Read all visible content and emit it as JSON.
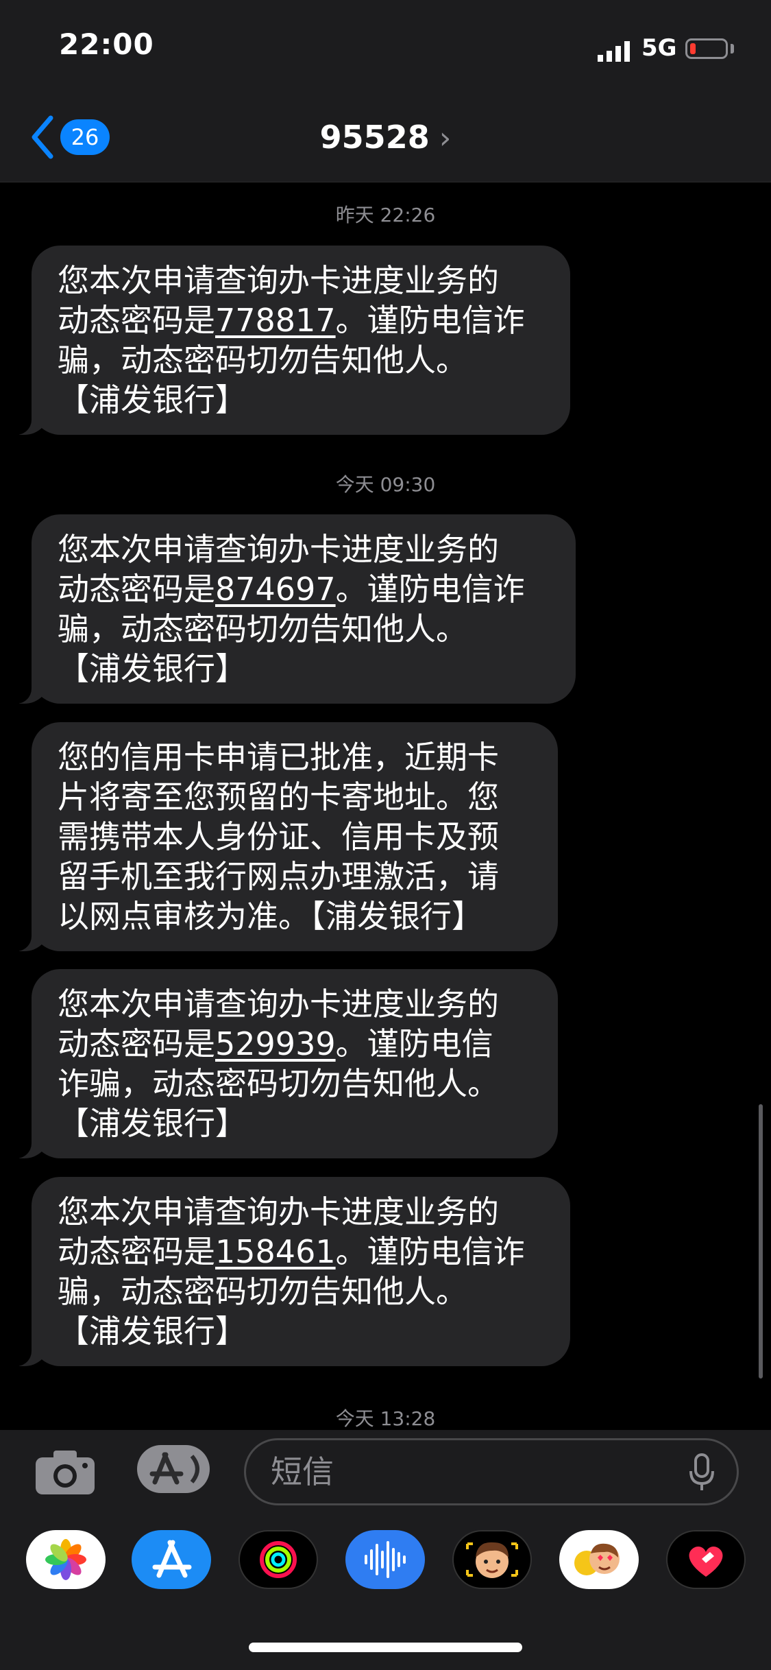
{
  "status_bar": {
    "time": "22:00",
    "network": "5G"
  },
  "nav": {
    "back_count": "26",
    "contact": "95528",
    "chevron": "›"
  },
  "messages": [
    {
      "stamp": "昨天 22:26",
      "lines": [
        "您本次申请查询办卡进度业务的",
        "动态密码是",
        "778817",
        "。谨防电信诈",
        "骗，动态密码切勿告知他人。",
        "【浦发银行】"
      ]
    },
    {
      "stamp": "今天 09:30",
      "lines": [
        "您本次申请查询办卡进度业务的",
        "动态密码是",
        "874697",
        "。谨防电信诈",
        "骗，动态密码切勿告知他人。",
        "【浦发银行】"
      ]
    },
    {
      "text": [
        "您的信用卡申请已批准，近期卡",
        "片将寄至您预留的卡寄地址。您",
        "需携带本人身份证、信用卡及预",
        "留手机至我行网点办理激活，请",
        "以网点审核为准。【浦发银行】"
      ]
    },
    {
      "lines": [
        "您本次申请查询办卡进度业务的",
        "动态密码是",
        "529939",
        "。谨防电信",
        "诈骗，动态密码切勿告知他人。",
        "【浦发银行】"
      ]
    },
    {
      "lines": [
        "您本次申请查询办卡进度业务的",
        "动态密码是",
        "158461",
        "。谨防电信诈",
        "骗，动态密码切勿告知他人。",
        "【浦发银行】"
      ]
    }
  ],
  "last_stamp": "今天 13:28",
  "compose": {
    "placeholder": "短信"
  },
  "apps": [
    {
      "name": "photos-app-icon",
      "color": "#ffffff"
    },
    {
      "name": "app-store-app-icon",
      "color": "#1c8cf5"
    },
    {
      "name": "activity-app-icon",
      "color": "#000000"
    },
    {
      "name": "audio-message-app-icon",
      "color": "#2f7df2"
    },
    {
      "name": "memoji-app-icon",
      "color": "#000000"
    },
    {
      "name": "memoji-stickers-app-icon",
      "color": "#ffffff"
    },
    {
      "name": "digital-touch-app-icon",
      "color": "#000000"
    }
  ],
  "colors": {
    "accent": "#0a84ff",
    "bubble": "#262628",
    "battery_low": "#ff3b30"
  }
}
